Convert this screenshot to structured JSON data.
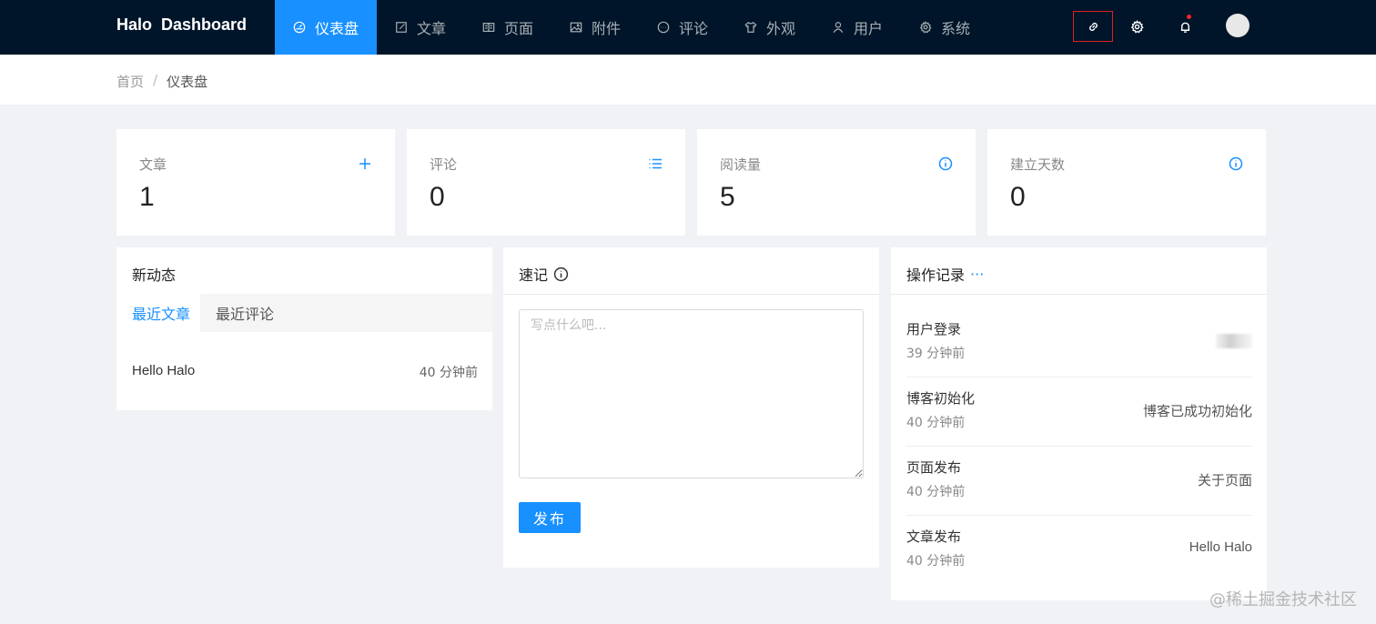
{
  "brand": "Halo  Dashboard",
  "nav": [
    {
      "label": "仪表盘",
      "icon": "dashboard-icon"
    },
    {
      "label": "文章",
      "icon": "edit-icon"
    },
    {
      "label": "页面",
      "icon": "read-icon"
    },
    {
      "label": "附件",
      "icon": "picture-icon"
    },
    {
      "label": "评论",
      "icon": "message-icon"
    },
    {
      "label": "外观",
      "icon": "skin-icon"
    },
    {
      "label": "用户",
      "icon": "user-icon"
    },
    {
      "label": "系统",
      "icon": "setting-icon"
    }
  ],
  "breadcrumb": {
    "home": "首页",
    "separator": "/",
    "current": "仪表盘"
  },
  "stats": [
    {
      "label": "文章",
      "value": "1",
      "icon": "plus-icon"
    },
    {
      "label": "评论",
      "value": "0",
      "icon": "unordered-list-icon"
    },
    {
      "label": "阅读量",
      "value": "5",
      "icon": "info-circle-icon"
    },
    {
      "label": "建立天数",
      "value": "0",
      "icon": "info-circle-icon"
    }
  ],
  "activity": {
    "title": "新动态",
    "tabs": [
      "最近文章",
      "最近评论"
    ],
    "items": [
      {
        "title": "Hello Halo",
        "time": "40 分钟前"
      }
    ]
  },
  "memo": {
    "title": "速记",
    "placeholder": "写点什么吧...",
    "publish": "发布"
  },
  "log": {
    "title": "操作记录",
    "more": "···",
    "items": [
      {
        "action": "用户登录",
        "time": "39 分钟前",
        "target": ""
      },
      {
        "action": "博客初始化",
        "time": "40 分钟前",
        "target": "博客已成功初始化"
      },
      {
        "action": "页面发布",
        "time": "40 分钟前",
        "target": "关于页面"
      },
      {
        "action": "文章发布",
        "time": "40 分钟前",
        "target": "Hello Halo"
      }
    ]
  },
  "watermark": "@稀土掘金技术社区",
  "colors": {
    "header": "#001529",
    "accent": "#1890ff",
    "background": "#f0f2f5"
  }
}
